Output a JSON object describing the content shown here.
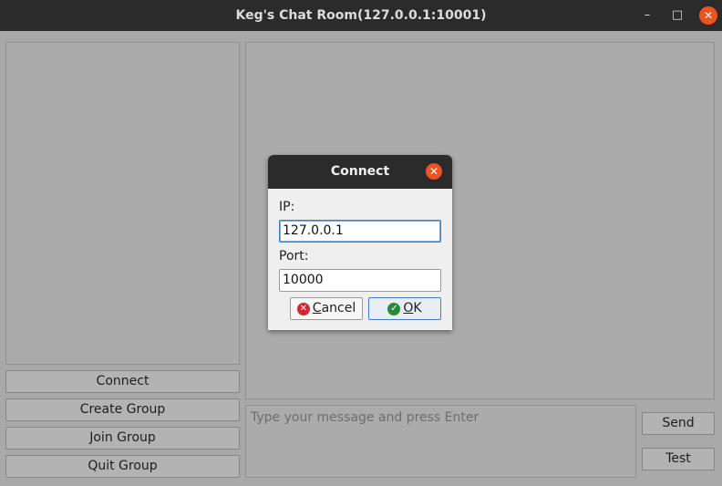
{
  "window": {
    "title": "Keg's Chat Room(127.0.0.1:10001)",
    "minimize_glyph": "–",
    "maximize_glyph": "□",
    "close_glyph": "✕"
  },
  "sidebar": {
    "buttons": [
      {
        "label": "Connect"
      },
      {
        "label": "Create Group"
      },
      {
        "label": "Join Group"
      },
      {
        "label": "Quit Group"
      }
    ]
  },
  "composer": {
    "placeholder": "Type your message and press Enter",
    "send_label": "Send",
    "test_label": "Test"
  },
  "dialog": {
    "title": "Connect",
    "close_glyph": "✕",
    "ip_label": "IP:",
    "ip_value": "127.0.0.1",
    "port_label": "Port:",
    "port_value": "10000",
    "cancel": {
      "mnemonic": "C",
      "rest": "ancel",
      "icon": "cancel-icon",
      "glyph": "✕"
    },
    "ok": {
      "mnemonic": "O",
      "rest": "K",
      "icon": "ok-check-icon",
      "glyph": "✓"
    }
  },
  "colors": {
    "titlebar": "#2b2b2b",
    "close_button": "#e95420",
    "focus_border": "#3d80c9"
  }
}
